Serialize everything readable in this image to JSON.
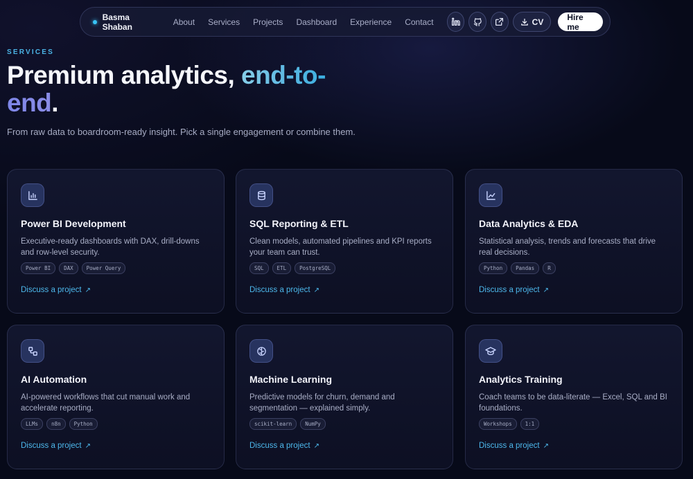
{
  "nav": {
    "brand": "Basma Shaban",
    "links": [
      "About",
      "Services",
      "Projects",
      "Dashboard",
      "Experience",
      "Contact"
    ],
    "cv_label": "CV",
    "hire_label": "Hire me",
    "icons": [
      "linkedin-icon",
      "github-icon",
      "external-link-icon",
      "download-icon"
    ]
  },
  "hero": {
    "eyebrow": "SERVICES",
    "headline_plain": "Premium analytics, ",
    "headline_accent_1": "end-to-",
    "headline_accent_2": "end",
    "headline_period": ".",
    "subtitle": "From raw data to boardroom-ready insight. Pick a single engagement or combine them."
  },
  "cta_label": "Discuss a project",
  "cards": [
    {
      "icon": "bar-chart-icon",
      "title": "Power BI Development",
      "desc": "Executive-ready dashboards with DAX, drill-downs and row-level security.",
      "tags": [
        "Power BI",
        "DAX",
        "Power Query"
      ]
    },
    {
      "icon": "database-icon",
      "title": "SQL Reporting & ETL",
      "desc": "Clean models, automated pipelines and KPI reports your team can trust.",
      "tags": [
        "SQL",
        "ETL",
        "PostgreSQL"
      ]
    },
    {
      "icon": "line-chart-icon",
      "title": "Data Analytics & EDA",
      "desc": "Statistical analysis, trends and forecasts that drive real decisions.",
      "tags": [
        "Python",
        "Pandas",
        "R"
      ]
    },
    {
      "icon": "workflow-icon",
      "title": "AI Automation",
      "desc": "AI-powered workflows that cut manual work and accelerate reporting.",
      "tags": [
        "LLMs",
        "n8n",
        "Python"
      ]
    },
    {
      "icon": "brain-icon",
      "title": "Machine Learning",
      "desc": "Predictive models for churn, demand and segmentation — explained simply.",
      "tags": [
        "scikit-learn",
        "NumPy"
      ]
    },
    {
      "icon": "graduation-cap-icon",
      "title": "Analytics Training",
      "desc": "Coach teams to be data-literate — Excel, SQL and BI foundations.",
      "tags": [
        "Workshops",
        "1:1"
      ]
    }
  ]
}
